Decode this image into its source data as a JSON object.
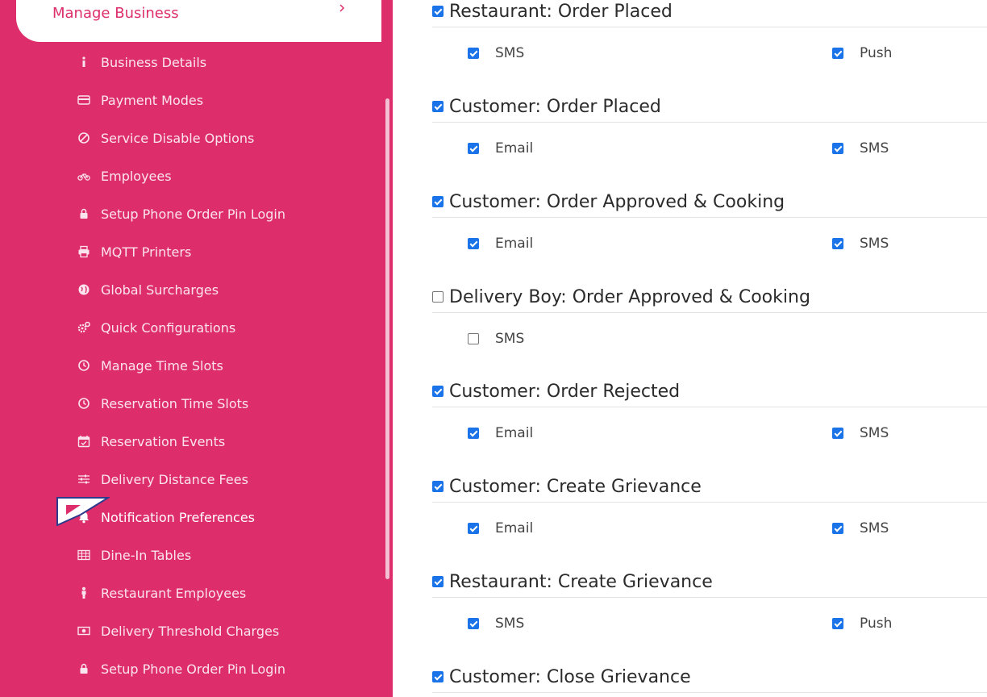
{
  "sidebar": {
    "active_parent": "Manage Business",
    "items": [
      {
        "label": "Business Details",
        "icon": "info-icon"
      },
      {
        "label": "Payment Modes",
        "icon": "credit-card-icon"
      },
      {
        "label": "Service Disable Options",
        "icon": "ban-icon"
      },
      {
        "label": "Employees",
        "icon": "motorcycle-icon"
      },
      {
        "label": "Setup Phone Order Pin Login",
        "icon": "lock-icon"
      },
      {
        "label": "MQTT Printers",
        "icon": "printer-icon"
      },
      {
        "label": "Global Surcharges",
        "icon": "globe-icon"
      },
      {
        "label": "Quick Configurations",
        "icon": "gears-icon"
      },
      {
        "label": "Manage Time Slots",
        "icon": "clock-icon"
      },
      {
        "label": "Reservation Time Slots",
        "icon": "clock-icon"
      },
      {
        "label": "Reservation Events",
        "icon": "calendar-check-icon"
      },
      {
        "label": "Delivery Distance Fees",
        "icon": "sliders-icon"
      },
      {
        "label": "Notification Preferences",
        "icon": "bell-icon",
        "active": true
      },
      {
        "label": "Dine-In Tables",
        "icon": "table-icon"
      },
      {
        "label": "Restaurant Employees",
        "icon": "person-icon"
      },
      {
        "label": "Delivery Threshold Charges",
        "icon": "money-icon"
      },
      {
        "label": "Setup Phone Order Pin Login",
        "icon": "lock-icon"
      }
    ]
  },
  "notifications": [
    {
      "title": "Restaurant: Order Placed",
      "checked": true,
      "options": [
        {
          "label": "SMS",
          "checked": true
        },
        {
          "label": "Push",
          "checked": true
        }
      ]
    },
    {
      "title": "Customer: Order Placed",
      "checked": true,
      "options": [
        {
          "label": "Email",
          "checked": true
        },
        {
          "label": "SMS",
          "checked": true
        }
      ]
    },
    {
      "title": "Customer: Order Approved & Cooking",
      "checked": true,
      "options": [
        {
          "label": "Email",
          "checked": true
        },
        {
          "label": "SMS",
          "checked": true
        }
      ]
    },
    {
      "title": "Delivery Boy: Order Approved & Cooking",
      "checked": false,
      "options": [
        {
          "label": "SMS",
          "checked": false
        }
      ]
    },
    {
      "title": "Customer: Order Rejected",
      "checked": true,
      "options": [
        {
          "label": "Email",
          "checked": true
        },
        {
          "label": "SMS",
          "checked": true
        }
      ]
    },
    {
      "title": "Customer: Create Grievance",
      "checked": true,
      "options": [
        {
          "label": "Email",
          "checked": true
        },
        {
          "label": "SMS",
          "checked": true
        }
      ]
    },
    {
      "title": "Restaurant: Create Grievance",
      "checked": true,
      "options": [
        {
          "label": "SMS",
          "checked": true
        },
        {
          "label": "Push",
          "checked": true
        }
      ]
    },
    {
      "title": "Customer: Close Grievance",
      "checked": true,
      "options": []
    }
  ],
  "colors": {
    "sidebar_bg": "#dd2e6b",
    "checkbox": "#1a73e8"
  }
}
